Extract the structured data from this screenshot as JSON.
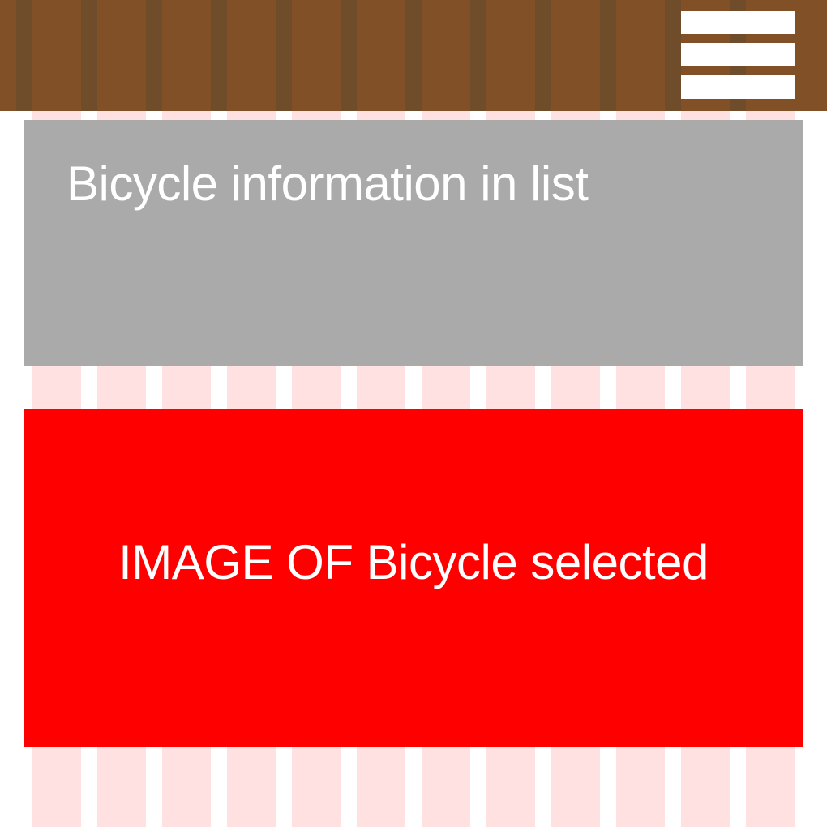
{
  "colors": {
    "page_background": "#ffffff",
    "grid_column": "#ffe1e1",
    "header_background": "#825026",
    "header_stripe": "#704d2a",
    "menu_icon": "#ffffff",
    "info_panel_background": "#aaaaaa",
    "image_panel_background": "#ff0000",
    "text": "#ffffff"
  },
  "header": {
    "menu_icon": "hamburger-menu-icon"
  },
  "info_panel": {
    "text": "Bicycle information in list"
  },
  "image_panel": {
    "text": "IMAGE OF Bicycle selected"
  }
}
